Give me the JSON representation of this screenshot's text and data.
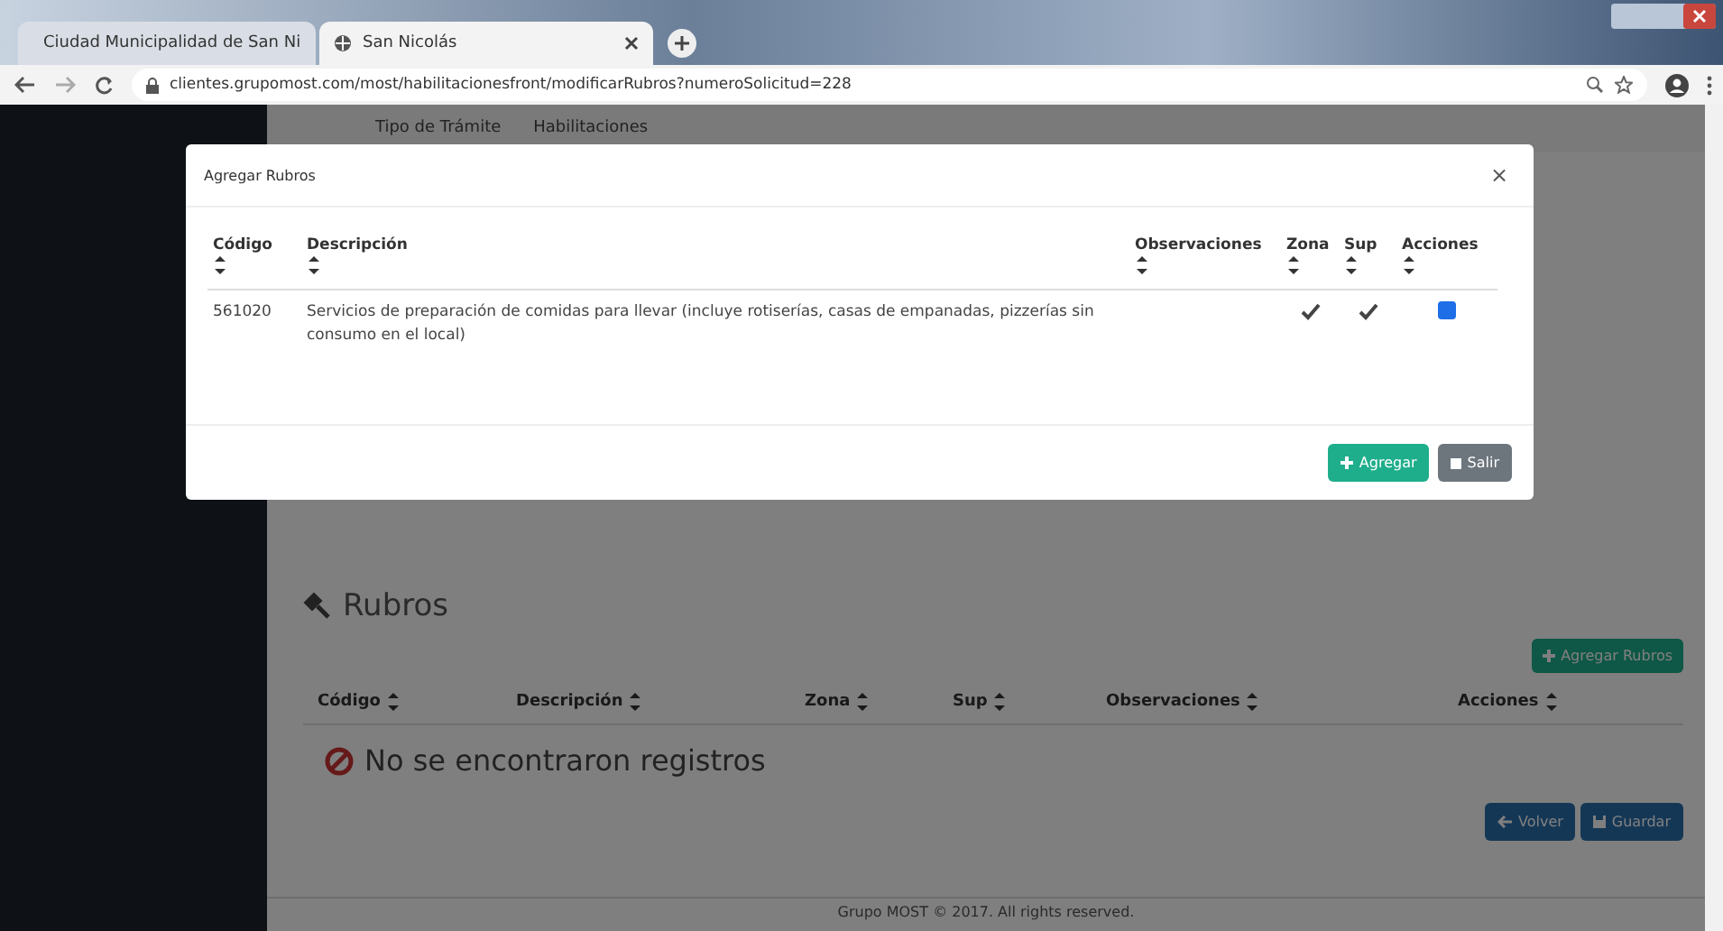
{
  "browser": {
    "tabs": [
      {
        "title": "Ciudad Municipalidad de San Ni",
        "selected": false
      },
      {
        "title": "San Nicolás",
        "selected": true
      }
    ],
    "url": "clientes.grupomost.com/most/habilitacionesfront/modificarRubros?numeroSolicitud=228"
  },
  "nav": [
    "Tipo de Trámite",
    "Habilitaciones"
  ],
  "section": {
    "title": "Rubros",
    "add_button": "Agregar Rubros",
    "columns": [
      "Código",
      "Descripción",
      "Zona",
      "Sup",
      "Observaciones",
      "Acciones"
    ],
    "empty_message": "No se encontraron registros",
    "buttons": [
      {
        "label": "Volver",
        "kind": "back"
      },
      {
        "label": "Guardar",
        "kind": "save"
      }
    ]
  },
  "footer": "Grupo MOST © 2017. All rights reserved.",
  "modal": {
    "title": "Agregar Rubros",
    "close": "×",
    "columns": [
      "Código",
      "Descripción",
      "Observaciones",
      "Zona",
      "Sup",
      "Acciones"
    ],
    "rows": [
      {
        "codigo": "561020",
        "descripcion": "Servicios de preparación de comidas para llevar (incluye rotiserías, casas de empanadas, pizzerías sin consumo en el local)",
        "zona": true,
        "sup": true,
        "checked": true
      }
    ],
    "buttons": [
      {
        "label": "Agregar",
        "kind": "add"
      },
      {
        "label": "Salir",
        "kind": "exit"
      }
    ]
  }
}
